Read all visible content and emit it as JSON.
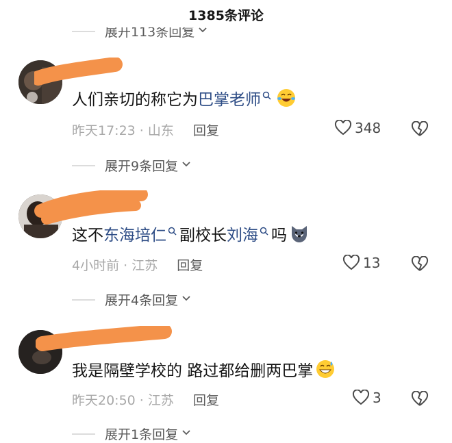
{
  "header": {
    "title": "1385条评论"
  },
  "prev_thread": {
    "expand_label": "展开113条回复"
  },
  "comments": [
    {
      "text_prefix": "人们亲切的称它为",
      "link1": "巴掌老师",
      "text_mid": "",
      "link2": "",
      "text_suffix": "",
      "emoji": "laughing-face",
      "time": "昨天17:23",
      "location": "山东",
      "reply_label": "回复",
      "likes": "348",
      "expand_label": "展开9条回复"
    },
    {
      "text_prefix": "这不",
      "link1": "东海培仁",
      "text_mid": "副校长",
      "link2": "刘海",
      "text_suffix": "吗",
      "emoji": "dog-face",
      "time": "4小时前",
      "location": "江苏",
      "reply_label": "回复",
      "likes": "13",
      "expand_label": "展开4条回复"
    },
    {
      "text_prefix": "我是隔壁学校的 路过都给删两巴掌",
      "link1": "",
      "text_mid": "",
      "link2": "",
      "text_suffix": "",
      "emoji": "grinning-sweat-face",
      "time": "昨天20:50",
      "location": "江苏",
      "reply_label": "回复",
      "likes": "3",
      "expand_label": "展开1条回复"
    }
  ],
  "colors": {
    "link": "#2e4d86",
    "scribble": "#f4924a",
    "meta": "#a8a8a8"
  }
}
